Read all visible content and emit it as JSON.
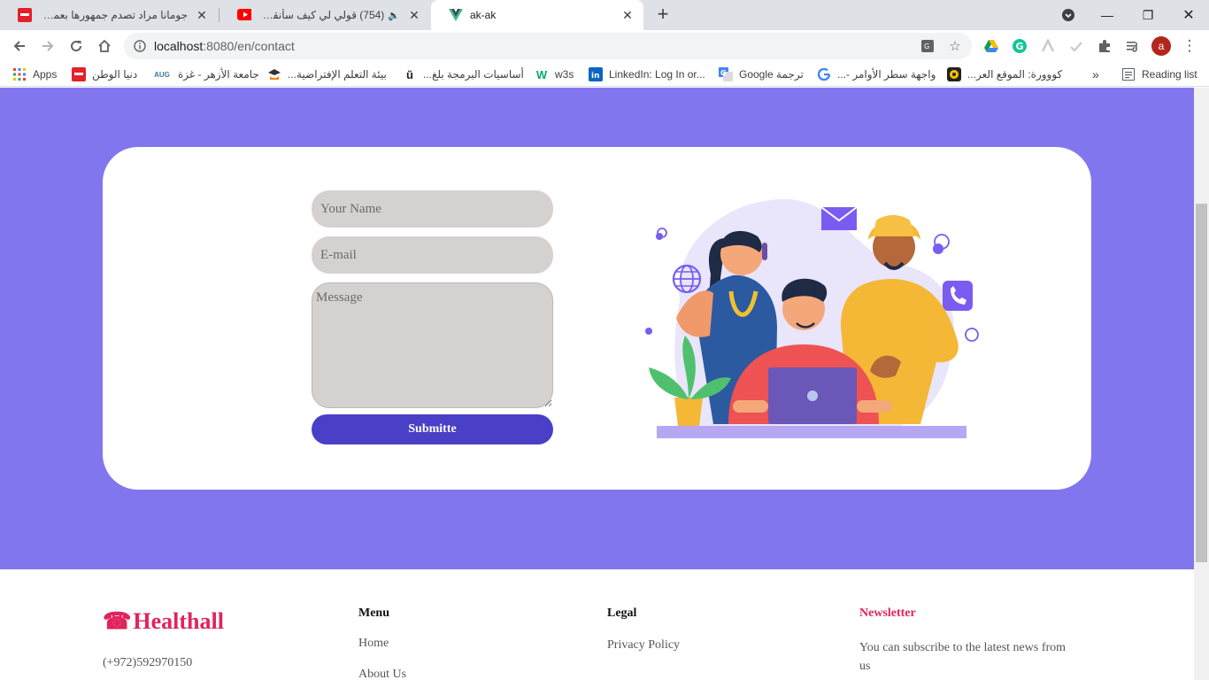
{
  "browser": {
    "tabs": [
      {
        "title": "جومانا مراد تصدم جمهورها بعمل فنـ",
        "icon": "watan-favicon",
        "active": false
      },
      {
        "title": "(754) قولي لي كيف سأنقذ نفسـ",
        "icon": "youtube-favicon",
        "active": false
      },
      {
        "title": "ak-ak",
        "icon": "vue-favicon",
        "active": true
      }
    ],
    "url_host": "localhost",
    "url_path": ":8080/en/contact",
    "avatar_letter": "a",
    "bookmarks": [
      {
        "label": "Apps",
        "icon": "apps-grid-icon"
      },
      {
        "label": "دنيا الوطن",
        "icon": "watan-icon"
      },
      {
        "label": "جامعة الأزهر - غزة",
        "icon": "azhar-icon"
      },
      {
        "label": "بيئة التعلم الإفتراضية...",
        "icon": "moodle-icon"
      },
      {
        "label": "أساسيات البرمجة بلغ...",
        "icon": "satr-icon"
      },
      {
        "label": "w3s",
        "icon": "w3schools-icon"
      },
      {
        "label": "LinkedIn: Log In or...",
        "icon": "linkedin-icon"
      },
      {
        "label": "Google ترجمة",
        "icon": "translate-icon"
      },
      {
        "label": "واجهة سطر الأوامر -...",
        "icon": "google-icon"
      },
      {
        "label": "كووورة: الموقع العر...",
        "icon": "kooora-icon"
      }
    ],
    "reading_list": "Reading list",
    "apps_short": "AUG"
  },
  "contact": {
    "name_placeholder": "Your Name",
    "email_placeholder": "E-mail",
    "message_placeholder": "Message",
    "submit_label": "Submitte"
  },
  "footer": {
    "brand": "Healthall",
    "phone": "(+972)592970150",
    "menu_title": "Menu",
    "menu_items": [
      "Home",
      "About Us"
    ],
    "legal_title": "Legal",
    "legal_items": [
      "Privacy Policy"
    ],
    "newsletter_title": "Newsletter",
    "newsletter_text": "You can subscribe to the latest news from us"
  },
  "colors": {
    "hero_bg": "#8276ee",
    "submit_bg": "#4a3fc7",
    "brand": "#e0245e"
  }
}
